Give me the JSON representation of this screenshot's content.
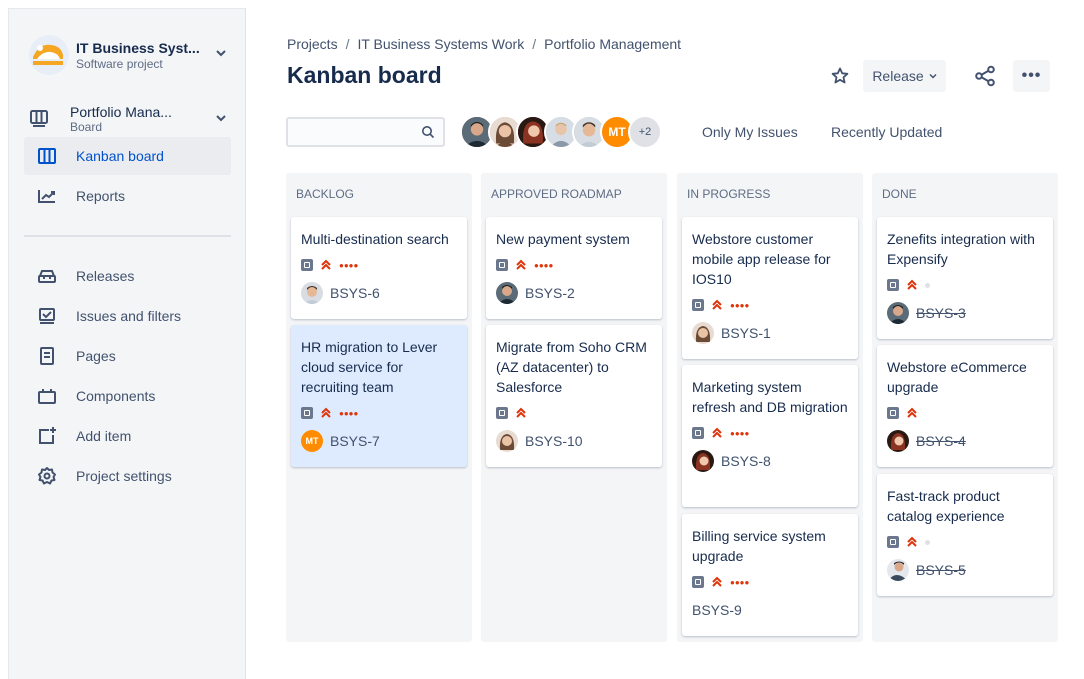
{
  "sidebar": {
    "project_name": "IT Business Syst...",
    "project_type": "Software project",
    "board_name": "Portfolio Mana...",
    "board_type": "Board",
    "nav": [
      {
        "label": "Kanban board",
        "icon": "board-icon"
      },
      {
        "label": "Reports",
        "icon": "reports-icon"
      },
      {
        "label": "Releases",
        "icon": "releases-icon"
      },
      {
        "label": "Issues and filters",
        "icon": "issues-icon"
      },
      {
        "label": "Pages",
        "icon": "pages-icon"
      },
      {
        "label": "Components",
        "icon": "components-icon"
      },
      {
        "label": "Add item",
        "icon": "add-item-icon"
      },
      {
        "label": "Project settings",
        "icon": "settings-icon"
      }
    ]
  },
  "header": {
    "breadcrumbs": [
      "Projects",
      "IT Business Systems Work",
      "Portfolio Management"
    ],
    "breadcrumb_sep": "/",
    "title": "Kanban board",
    "release_label": "Release",
    "more_label": "•••"
  },
  "filters": {
    "search_placeholder": "",
    "avatar_initials": "MT",
    "avatar_more": "+2",
    "only_my_issues": "Only My Issues",
    "recently_updated": "Recently Updated"
  },
  "columns": [
    {
      "title": "BACKLOG",
      "cards": [
        {
          "title": "Multi-destination search",
          "key": "BSYS-6"
        },
        {
          "title": "HR migration to Lever cloud service for recruiting team",
          "key": "BSYS-7",
          "assignee_initials": "MT"
        }
      ]
    },
    {
      "title": "APPROVED ROADMAP",
      "cards": [
        {
          "title": "New payment system",
          "key": "BSYS-2"
        },
        {
          "title": "Migrate from Soho CRM (AZ datacenter) to Salesforce",
          "key": "BSYS-10"
        }
      ]
    },
    {
      "title": "IN PROGRESS",
      "cards": [
        {
          "title": "Webstore customer mobile app release for IOS10",
          "key": "BSYS-1"
        },
        {
          "title": "Marketing system refresh and DB migration",
          "key": "BSYS-8"
        },
        {
          "title": "Billing service system upgrade",
          "key": "BSYS-9"
        }
      ]
    },
    {
      "title": "DONE",
      "cards": [
        {
          "title": "Zenefits integration with Expensify",
          "key": "BSYS-3"
        },
        {
          "title": "Webstore eCommerce upgrade",
          "key": "BSYS-4"
        },
        {
          "title": "Fast-track product catalog experience",
          "key": "BSYS-5"
        }
      ]
    }
  ],
  "colors": {
    "accent": "#0052cc",
    "priority": "#de350b",
    "selected_card": "#deebff",
    "avatar_orange": "#ff8b00"
  }
}
